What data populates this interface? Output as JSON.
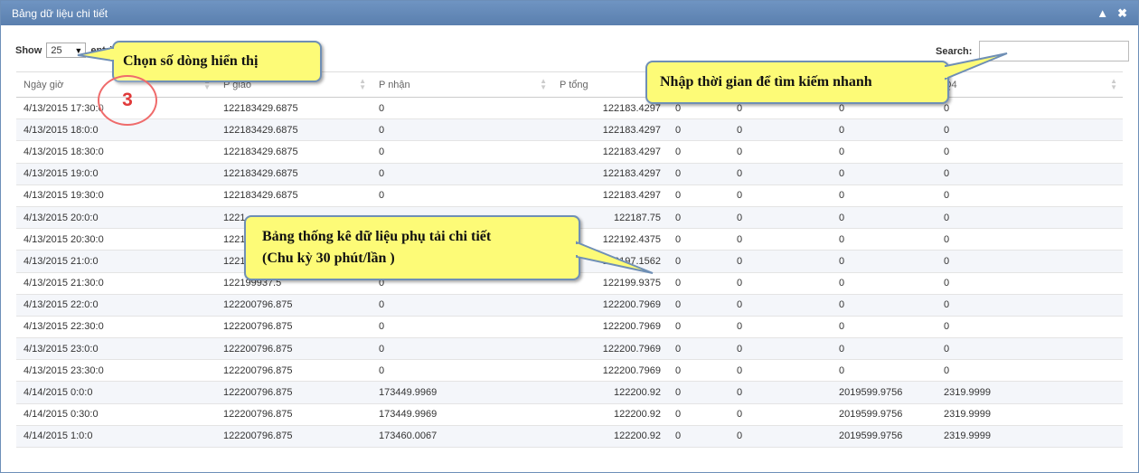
{
  "panel": {
    "title": "Bảng dữ liệu chi tiết",
    "collapse_icon": "chevron-up-icon",
    "close_icon": "close-icon"
  },
  "length": {
    "label_show": "Show",
    "value": "25",
    "label_entries": "entries"
  },
  "search": {
    "label": "Search:",
    "value": "",
    "placeholder": ""
  },
  "columns": [
    "Ngày giờ",
    "P giao",
    "P nhận",
    "P tổng",
    "",
    "",
    "",
    "Q4"
  ],
  "rows": [
    [
      "4/13/2015 17:30:0",
      "122183429.6875",
      "0",
      "122183.4297",
      "0",
      "0",
      "0",
      "0"
    ],
    [
      "4/13/2015 18:0:0",
      "122183429.6875",
      "0",
      "122183.4297",
      "0",
      "0",
      "0",
      "0"
    ],
    [
      "4/13/2015 18:30:0",
      "122183429.6875",
      "0",
      "122183.4297",
      "0",
      "0",
      "0",
      "0"
    ],
    [
      "4/13/2015 19:0:0",
      "122183429.6875",
      "0",
      "122183.4297",
      "0",
      "0",
      "0",
      "0"
    ],
    [
      "4/13/2015 19:30:0",
      "122183429.6875",
      "0",
      "122183.4297",
      "0",
      "0",
      "0",
      "0"
    ],
    [
      "4/13/2015 20:0:0",
      "1221",
      "",
      "122187.75",
      "0",
      "0",
      "0",
      "0"
    ],
    [
      "4/13/2015 20:30:0",
      "1221",
      "",
      "122192.4375",
      "0",
      "0",
      "0",
      "0"
    ],
    [
      "4/13/2015 21:0:0",
      "1221",
      "",
      "122197.1562",
      "0",
      "0",
      "0",
      "0"
    ],
    [
      "4/13/2015 21:30:0",
      "122199937.5",
      "0",
      "122199.9375",
      "0",
      "0",
      "0",
      "0"
    ],
    [
      "4/13/2015 22:0:0",
      "122200796.875",
      "0",
      "122200.7969",
      "0",
      "0",
      "0",
      "0"
    ],
    [
      "4/13/2015 22:30:0",
      "122200796.875",
      "0",
      "122200.7969",
      "0",
      "0",
      "0",
      "0"
    ],
    [
      "4/13/2015 23:0:0",
      "122200796.875",
      "0",
      "122200.7969",
      "0",
      "0",
      "0",
      "0"
    ],
    [
      "4/13/2015 23:30:0",
      "122200796.875",
      "0",
      "122200.7969",
      "0",
      "0",
      "0",
      "0"
    ],
    [
      "4/14/2015 0:0:0",
      "122200796.875",
      "173449.9969",
      "122200.92",
      "0",
      "0",
      "2019599.9756",
      "2319.9999"
    ],
    [
      "4/14/2015 0:30:0",
      "122200796.875",
      "173449.9969",
      "122200.92",
      "0",
      "0",
      "2019599.9756",
      "2319.9999"
    ],
    [
      "4/14/2015 1:0:0",
      "122200796.875",
      "173460.0067",
      "122200.92",
      "0",
      "0",
      "2019599.9756",
      "2319.9999"
    ]
  ],
  "annotations": {
    "rows_callout": "Chọn số dòng hiển thị",
    "search_callout": "Nhập thời gian để tìm kiếm nhanh",
    "table_callout_line1": "Bảng thống kê dữ liệu phụ tải chi tiết",
    "table_callout_line2": "(Chu kỳ 30 phút/lần )",
    "step_number": "3"
  },
  "colors": {
    "titlebar": "#5f84b3",
    "callout_bg": "#fdfb77",
    "callout_border": "#6f8fb5",
    "step_circle": "#ef6b6b"
  }
}
